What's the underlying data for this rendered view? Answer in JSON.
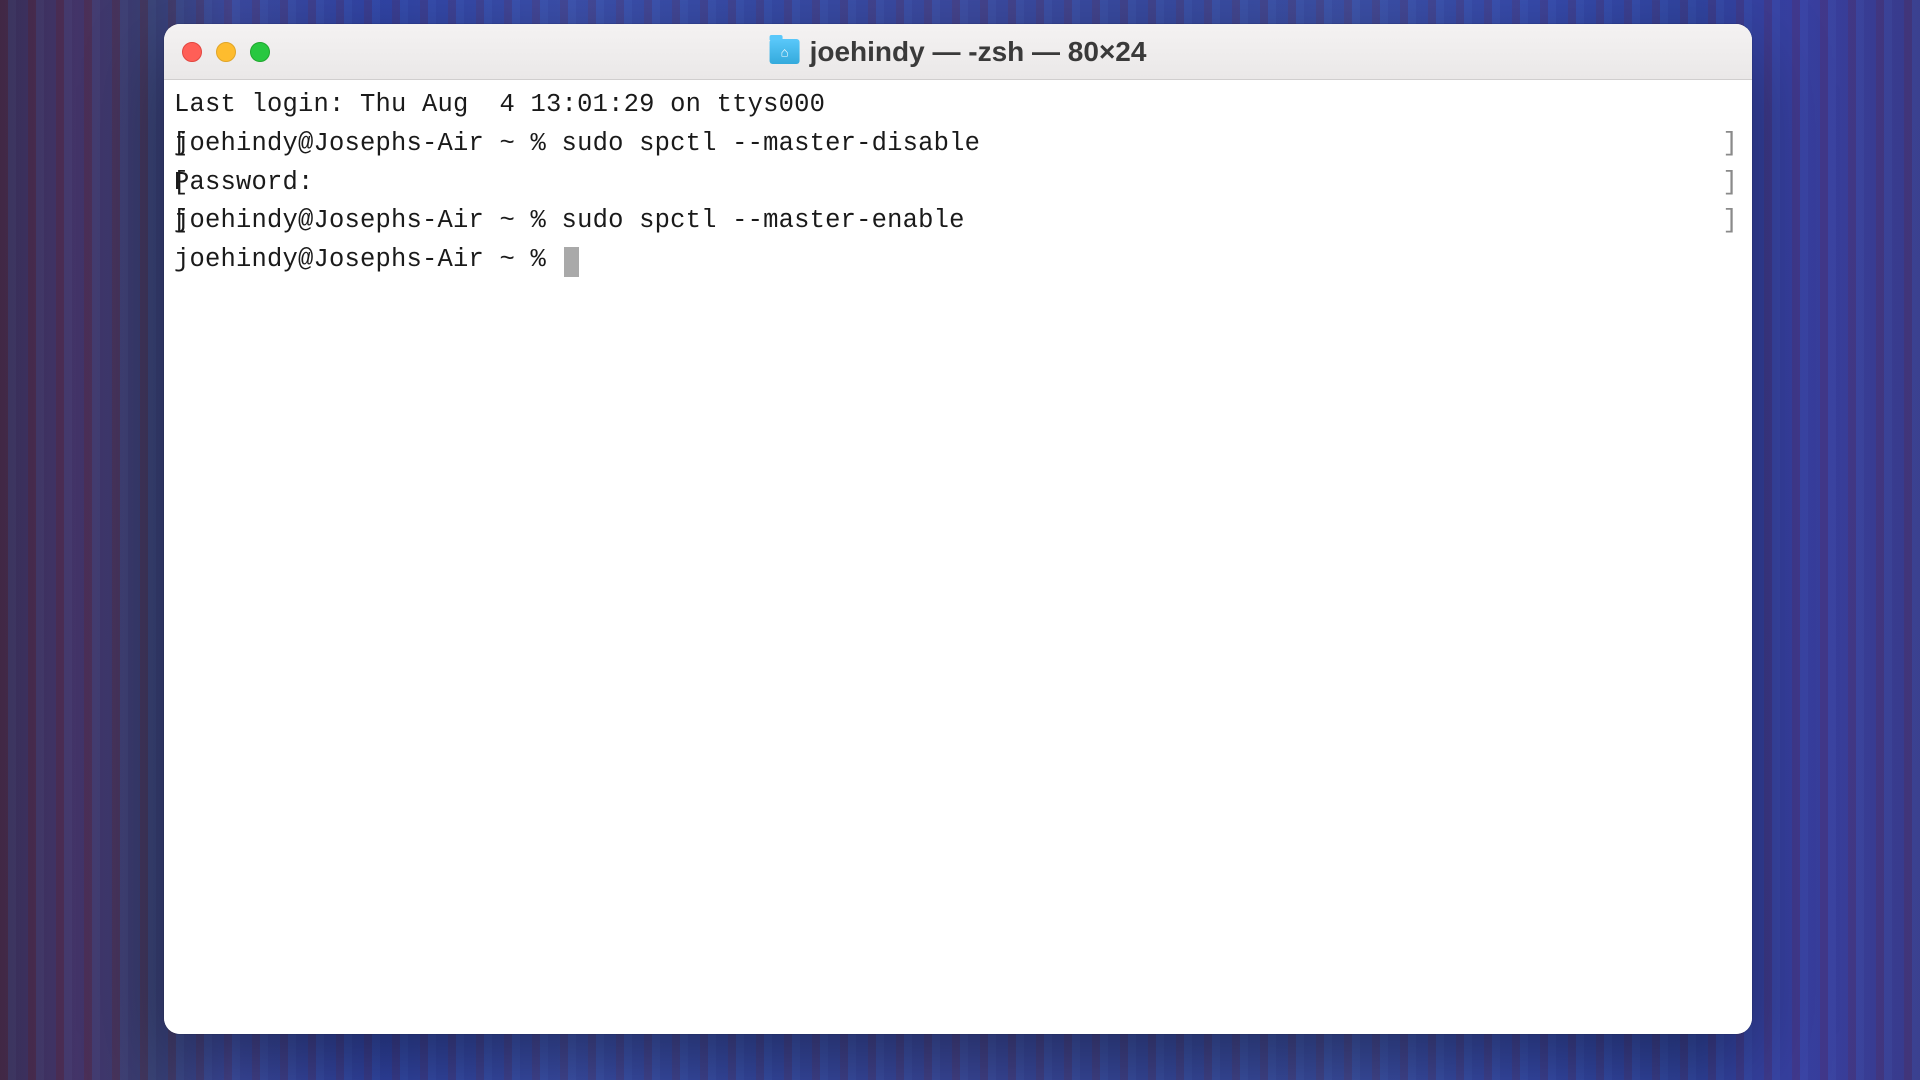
{
  "window": {
    "title_text": "joehindy — -zsh — 80×24"
  },
  "terminal": {
    "lines": [
      {
        "left_bracket": "",
        "content": "Last login: Thu Aug  4 13:01:29 on ttys000",
        "right_bracket": ""
      },
      {
        "left_bracket": "[",
        "content": "joehindy@Josephs-Air ~ % sudo spctl --master-disable",
        "right_bracket": "]"
      },
      {
        "left_bracket": "[",
        "content": "Password:",
        "right_bracket": "]"
      },
      {
        "left_bracket": "[",
        "content": "joehindy@Josephs-Air ~ % sudo spctl --master-enable",
        "right_bracket": "]"
      }
    ],
    "current_prompt": "joehindy@Josephs-Air ~ % "
  }
}
